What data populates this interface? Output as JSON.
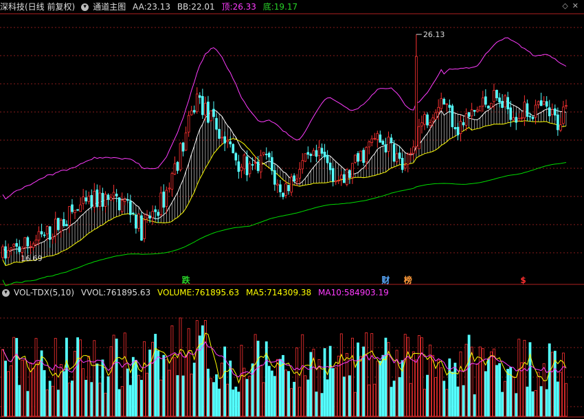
{
  "main_header": {
    "stock": "深科技(日线 前复权)",
    "indicator": "通道主图",
    "aa_label": "AA:",
    "aa_value": "23.13",
    "bb_label": "BB:",
    "bb_value": "22.01",
    "top_label": "顶:",
    "top_value": "26.33",
    "bottom_label": "底:",
    "bottom_value": "19.17"
  },
  "vol_header": {
    "name": "VOL-TDX(5,10)",
    "vvol_label": "VVOL:",
    "vvol_value": "761895.63",
    "volume_label": "VOLUME:",
    "volume_value": "761895.63",
    "ma5_label": "MA5:",
    "ma5_value": "714309.38",
    "ma10_label": "MA10:",
    "ma10_value": "584903.19"
  },
  "annotations": {
    "high_label": "26.13",
    "low_label": "16.69",
    "markers": [
      {
        "text": "跌",
        "color": "#28d228",
        "bar": 66
      },
      {
        "text": "财",
        "color": "#5aaaff",
        "bar": 138
      },
      {
        "text": "榜",
        "color": "#ff9a3a",
        "bar": 146
      },
      {
        "text": "$",
        "color": "#ff3030",
        "bar": 188
      }
    ]
  },
  "colors": {
    "up": "#ff3232",
    "down": "#54ffff",
    "upper_band": "#ff3cff",
    "mid_line": "#ffffff",
    "lower_band": "#ffff00",
    "long_ma": "#00dd00",
    "grid": "#8a1b1b",
    "vol_ma5": "#ffff00",
    "vol_ma10": "#ff3cff"
  },
  "chart_data": {
    "type": "candlestick",
    "price_range": [
      16.0,
      27.0
    ],
    "volume_max": 1000000,
    "n_bars": 204,
    "last_close": 23.13,
    "high_price": 26.13,
    "low_price": 16.69
  }
}
